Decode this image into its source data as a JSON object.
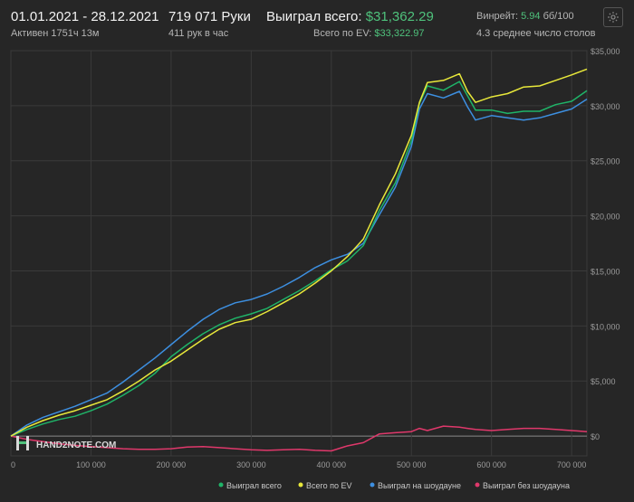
{
  "header": {
    "date_range": "01.01.2021 - 28.12.2021",
    "active": "Активен 1751ч 13м",
    "hands": "719 071 Руки",
    "hands_per_hour": "411 рук в час",
    "won_label": "Выиграл всего:",
    "won_value": "$31,362.29",
    "ev_label": "Всего по EV:",
    "ev_value": "$33,322.97",
    "winrate_label": "Винрейт:",
    "winrate_value": "5.94",
    "winrate_unit": "бб/100",
    "tables": "4.3 среднее число столов"
  },
  "logo_text": "HAND2NOTE.COM",
  "icons": {
    "settings": "gear-icon",
    "logo": "hand2note-logo-icon"
  },
  "colors": {
    "background": "#262626",
    "grid": "#3a3a3a",
    "won": "#1fb468",
    "ev": "#e8e83a",
    "showdown": "#3d8fe0",
    "non_showdown": "#e0386b"
  },
  "chart_data": {
    "type": "line",
    "x_ticks": [
      "0",
      "100 000",
      "200 000",
      "300 000",
      "400 000",
      "500 000",
      "600 000",
      "700 000"
    ],
    "x_tick_values": [
      0,
      100000,
      200000,
      300000,
      400000,
      500000,
      600000,
      700000
    ],
    "y_ticks": [
      "$35,000",
      "$30,000",
      "$25,000",
      "$20,000",
      "$15,000",
      "$10,000",
      "$5,000",
      "$0"
    ],
    "y_tick_values": [
      35000,
      30000,
      25000,
      20000,
      15000,
      10000,
      5000,
      0
    ],
    "xlim": [
      0,
      719071
    ],
    "ylim": [
      -1800,
      35000
    ],
    "grid": true,
    "legend_position": "bottom-right",
    "x": [
      0,
      20000,
      40000,
      60000,
      80000,
      100000,
      120000,
      140000,
      160000,
      180000,
      200000,
      220000,
      240000,
      260000,
      280000,
      300000,
      320000,
      340000,
      360000,
      380000,
      400000,
      420000,
      440000,
      460000,
      480000,
      500000,
      510000,
      520000,
      540000,
      560000,
      570000,
      580000,
      600000,
      620000,
      640000,
      660000,
      680000,
      700000,
      719071
    ],
    "series": [
      {
        "name": "Выиграл всего",
        "color": "#1fb468",
        "values": [
          0,
          600,
          1100,
          1500,
          1800,
          2300,
          2900,
          3700,
          4600,
          5700,
          7200,
          8300,
          9300,
          10100,
          10700,
          11100,
          11600,
          12400,
          13200,
          14100,
          15100,
          15900,
          17300,
          20500,
          23000,
          26800,
          30200,
          31800,
          31400,
          32200,
          30900,
          29600,
          29600,
          29300,
          29500,
          29500,
          30100,
          30400,
          31362
        ]
      },
      {
        "name": "Всего по EV",
        "color": "#e8e83a",
        "values": [
          0,
          800,
          1400,
          1900,
          2300,
          2800,
          3300,
          4100,
          5000,
          6000,
          6800,
          7800,
          8800,
          9700,
          10300,
          10600,
          11300,
          12100,
          12900,
          13900,
          15000,
          16300,
          17900,
          21000,
          23800,
          27300,
          30300,
          32100,
          32300,
          32900,
          31300,
          30300,
          30800,
          31100,
          31700,
          31800,
          32300,
          32800,
          33323
        ]
      },
      {
        "name": "Выиграл на шоудауне",
        "color": "#3d8fe0",
        "values": [
          0,
          1000,
          1700,
          2200,
          2700,
          3300,
          3900,
          4900,
          6000,
          7100,
          8300,
          9500,
          10600,
          11500,
          12100,
          12400,
          12900,
          13600,
          14400,
          15300,
          16000,
          16500,
          17500,
          20100,
          22600,
          26300,
          29700,
          31100,
          30700,
          31300,
          29900,
          28700,
          29100,
          28900,
          28700,
          28900,
          29300,
          29700,
          30600
        ]
      },
      {
        "name": "Выиграл без шоудауна",
        "color": "#e0386b",
        "values": [
          0,
          -300,
          -500,
          -700,
          -850,
          -950,
          -1050,
          -1150,
          -1200,
          -1200,
          -1150,
          -1000,
          -950,
          -1050,
          -1150,
          -1250,
          -1300,
          -1250,
          -1200,
          -1300,
          -1350,
          -900,
          -600,
          200,
          300,
          400,
          700,
          500,
          900,
          800,
          700,
          600,
          500,
          600,
          700,
          700,
          600,
          500,
          400
        ]
      }
    ]
  }
}
